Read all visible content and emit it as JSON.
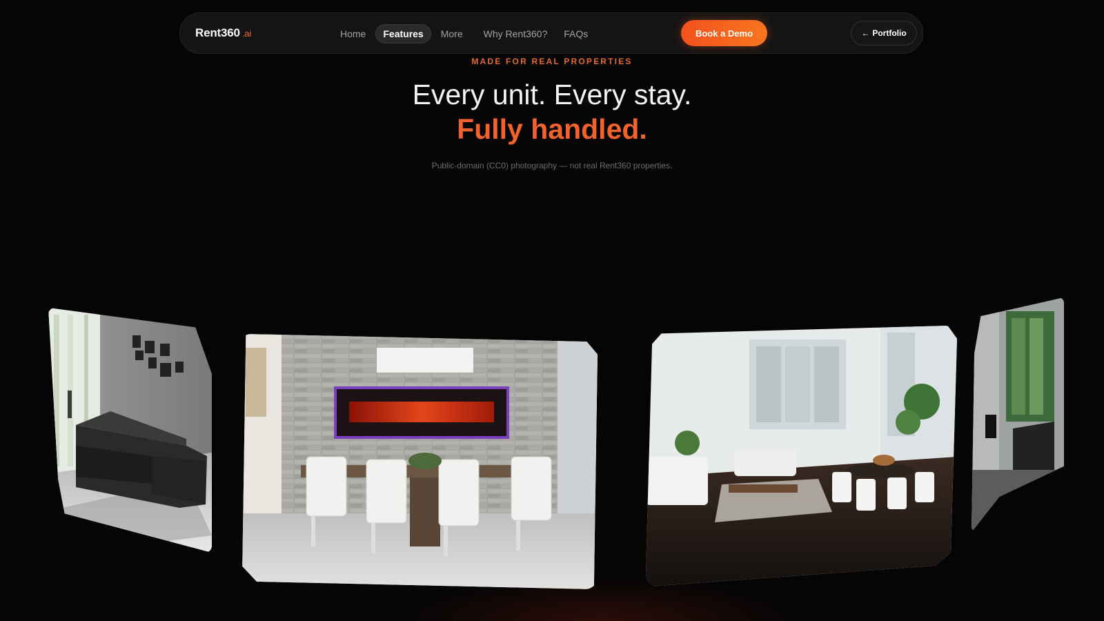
{
  "nav": {
    "brand": "Rent360",
    "brand_suffix": ".ai",
    "links": [
      {
        "label": "Home",
        "active": false
      },
      {
        "label": "Features",
        "active": true
      },
      {
        "label": "More",
        "active": false
      },
      {
        "label": "Why Rent360?",
        "active": false
      },
      {
        "label": "FAQs",
        "active": false
      }
    ],
    "demo_button": "Book a Demo",
    "portfolio_arrow": "←",
    "portfolio_button": "Portfolio"
  },
  "hero": {
    "eyebrow": "MADE FOR REAL PROPERTIES",
    "headline": "Every unit. Every stay.",
    "headline_accent": "Fully handled.",
    "caption": "Public-domain (CC0) photography — not real Rent360 properties."
  },
  "colors": {
    "accent": "#f2622b",
    "background": "#050505",
    "nav_bg": "#141414"
  },
  "carousel": {
    "cards": [
      {
        "scene": "living-room-black-sectional-sofa"
      },
      {
        "scene": "dining-room-fireplace-white-chairs"
      },
      {
        "scene": "apartment-living-dining-white-chairs"
      },
      {
        "scene": "living-room-window-plants"
      }
    ]
  }
}
